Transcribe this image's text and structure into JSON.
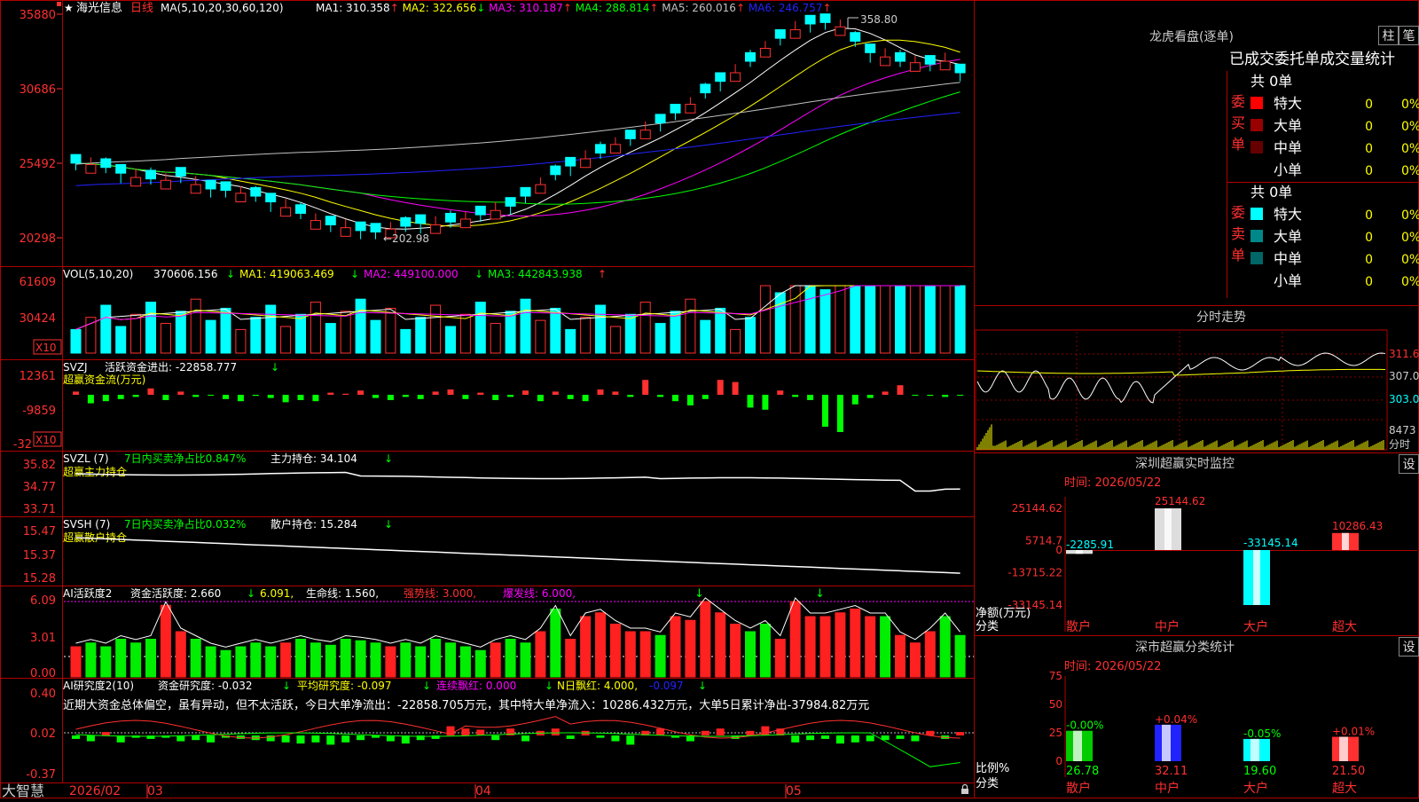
{
  "app": {
    "brand": "大智慧",
    "dates": [
      "2026/02",
      "03",
      "04",
      "05"
    ]
  },
  "main_chart": {
    "stock_name": "海光信息",
    "period": "日线",
    "ma_params": "MA(5,10,20,30,60,120)",
    "indicators": [
      {
        "label": "MA1: 310.358",
        "arrow": "↑",
        "color": "#ffffff"
      },
      {
        "label": "MA2: 322.656",
        "arrow": "↓",
        "color": "#ffff00"
      },
      {
        "label": "MA3: 310.187",
        "arrow": "↑",
        "color": "#ff00ff"
      },
      {
        "label": "MA4: 288.814",
        "arrow": "↑",
        "color": "#00ff00"
      },
      {
        "label": "MA5: 260.016",
        "arrow": "↑",
        "color": "#c0c0c0"
      },
      {
        "label": "MA6: 246.757",
        "arrow": "↑",
        "color": "#2222ff"
      }
    ],
    "y_ticks": [
      "35880",
      "30686",
      "25492",
      "20298"
    ],
    "high_label": "358.80",
    "low_label": "←202.98"
  },
  "volume": {
    "title": "VOL(5,10,20)",
    "value": "370606.156",
    "ma1": "MA1: 419063.469",
    "ma2": "MA2: 449100.000",
    "ma3": "MA3: 442843.938",
    "y_ticks": [
      "61609",
      "30424"
    ],
    "unit": "X10"
  },
  "svzj": {
    "title": "SVZJ",
    "label": "活跃资金进出: -22858.777",
    "sub": "超赢资金流(万元)",
    "y_ticks": [
      "12361",
      "-9859",
      "-32"
    ],
    "unit": "X10"
  },
  "svzl": {
    "title": "SVZL (7)",
    "green": "7日内买卖净占比0.847%",
    "label": "主力持仓: 34.104",
    "sub": "超赢主力持仓",
    "y_ticks": [
      "35.82",
      "34.77",
      "33.71"
    ]
  },
  "svsh": {
    "title": "SVSH (7)",
    "green": "7日内买卖净占比0.032%",
    "label": "散户持仓: 15.284",
    "sub": "超赢散户持仓",
    "y_ticks": [
      "15.47",
      "15.37",
      "15.28"
    ]
  },
  "ai_active": {
    "title": "AI活跃度2",
    "label": "资金活跃度: 2.660",
    "v2": "6.091,",
    "v3": "生命线: 1.560,",
    "v4": "强势线: 3.000,",
    "v5": "爆发线: 6.000,",
    "y_ticks": [
      "6.09",
      "3.01",
      "0.00"
    ]
  },
  "ai_research": {
    "title": "AI研究度2(10)",
    "label": "资金研究度: -0.032",
    "v2": "平均研究度: -0.097",
    "v3": "连续飘红: 0.000",
    "v4": "N日飘红: 4.000,",
    "v5": "-0.097",
    "summary": "近期大资金总体偏空，虽有异动，但不太活跃，今日大单净流出：-22858.705万元，其中特大单净流入：10286.432万元，大单5日累计净出-37984.82万元",
    "y_ticks": [
      "0.40",
      "0.02",
      "-0.37"
    ]
  },
  "dragon_panel": {
    "title": "龙虎看盘(逐单)",
    "btn_bar": "柱",
    "btn_stroke": "笔",
    "header": "已成交委托单成交量统计",
    "buy_side": "委买单",
    "sell_side": "委卖单",
    "buy_total": "共 0单",
    "sell_total": "共 0单",
    "buy_rows": [
      {
        "label": "特大",
        "count": "0",
        "pct": "0%",
        "color": "#ff0000"
      },
      {
        "label": "大单",
        "count": "0",
        "pct": "0%",
        "color": "#990000"
      },
      {
        "label": "中单",
        "count": "0",
        "pct": "0%",
        "color": "#660000"
      },
      {
        "label": "小单",
        "count": "0",
        "pct": "0%",
        "color": "#000000"
      }
    ],
    "sell_rows": [
      {
        "label": "特大",
        "count": "0",
        "pct": "0%",
        "color": "#00ffff"
      },
      {
        "label": "大单",
        "count": "0",
        "pct": "0%",
        "color": "#008888"
      },
      {
        "label": "中单",
        "count": "0",
        "pct": "0%",
        "color": "#006666"
      },
      {
        "label": "小单",
        "count": "0",
        "pct": "0%",
        "color": "#000000"
      }
    ]
  },
  "intraday": {
    "title": "分时走势",
    "prices": [
      "311.6",
      "307.0",
      "303.0"
    ],
    "volume": "8473",
    "unit": "分时"
  },
  "sz_monitor": {
    "title": "深圳超赢实时监控",
    "btn": "设",
    "time": "时间: 2026/05/22",
    "y_ticks": [
      "25144.62",
      "5714.7",
      "0",
      "-13715.22",
      "-33145.14"
    ],
    "y_label": "净额(万元)",
    "x_label": "分类",
    "categories": [
      "散户",
      "中户",
      "大户",
      "超大"
    ],
    "values": [
      -2285.91,
      25144.62,
      -33145.14,
      10286.43
    ],
    "value_labels": [
      "-2285.91",
      "25144.62",
      "-33145.14",
      "10286.43"
    ]
  },
  "sz_class": {
    "title": "深市超赢分类统计",
    "btn": "设",
    "time": "时间: 2026/05/22",
    "y_ticks": [
      "75",
      "50",
      "25",
      "0"
    ],
    "y_label": "比例%",
    "x_label": "分类",
    "categories": [
      "散户",
      "中户",
      "大户",
      "超大"
    ],
    "values": [
      26.78,
      32.11,
      19.6,
      21.5
    ],
    "value_labels": [
      "26.78",
      "32.11",
      "19.60",
      "21.50"
    ],
    "changes": [
      "-0.00%",
      "+0.04%",
      "-0.05%",
      "+0.01%"
    ]
  }
}
